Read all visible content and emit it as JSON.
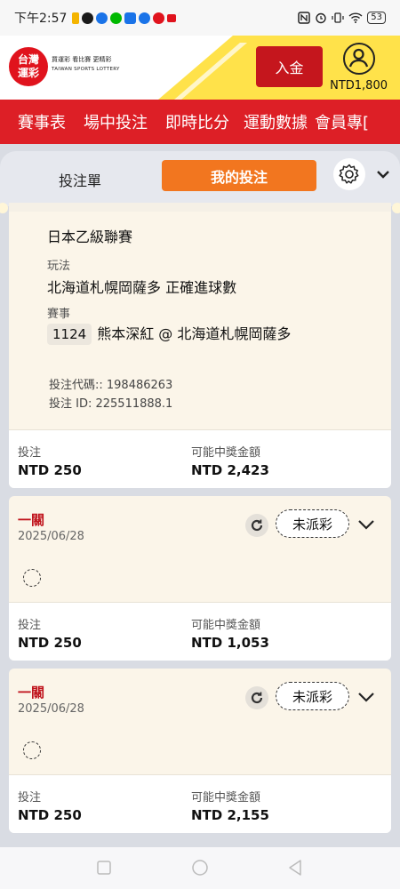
{
  "status_bar": {
    "time": "下午2:57",
    "battery": "53",
    "icon_colors": [
      "#f4b400",
      "#1a1a1a",
      "#1a73e8",
      "#00b900",
      "#1a73e8",
      "#1a73e8",
      "#e0131d",
      "#e0131d"
    ]
  },
  "header": {
    "logo_line1": "台灣",
    "logo_line2": "運彩",
    "logo_tagline": "買運彩 看比賽 更精彩",
    "logo_en": "TAIWAN SPORTS LOTTERY",
    "deposit_label": "入金",
    "balance": "NTD1,800"
  },
  "nav": {
    "items": [
      "賽事表",
      "場中投注",
      "即時比分",
      "運動數據",
      "會員專["
    ]
  },
  "tabs": {
    "slip_label": "投注單",
    "mine_label": "我的投注"
  },
  "card1": {
    "league_value": "日本乙級聯賽",
    "market_label": "玩法",
    "market_value": "北海道札幌岡薩多 正確進球數",
    "event_label": "賽事",
    "event_number": "1124",
    "event_name": "熊本深紅 @ 北海道札幌岡薩多",
    "bet_code": "投注代碼:: 198486263",
    "bet_id": "投注 ID: 225511888.1",
    "stake_label": "投注",
    "stake_value": "NTD 250",
    "payout_label": "可能中獎金額",
    "payout_value": "NTD 2,423"
  },
  "card2": {
    "type": "一關",
    "date": "2025/06/28",
    "status": "未派彩",
    "stake_label": "投注",
    "stake_value": "NTD 250",
    "payout_label": "可能中獎金額",
    "payout_value": "NTD 1,053"
  },
  "card3": {
    "type": "一關",
    "date": "2025/06/28",
    "status": "未派彩",
    "stake_label": "投注",
    "stake_value": "NTD 250",
    "payout_label": "可能中獎金額",
    "payout_value": "NTD 2,155"
  },
  "colors": {
    "brand_red": "#dd1f26",
    "accent_orange": "#f2761f",
    "brand_yellow": "#ffe24a",
    "card_bg": "#fbf5e9"
  }
}
